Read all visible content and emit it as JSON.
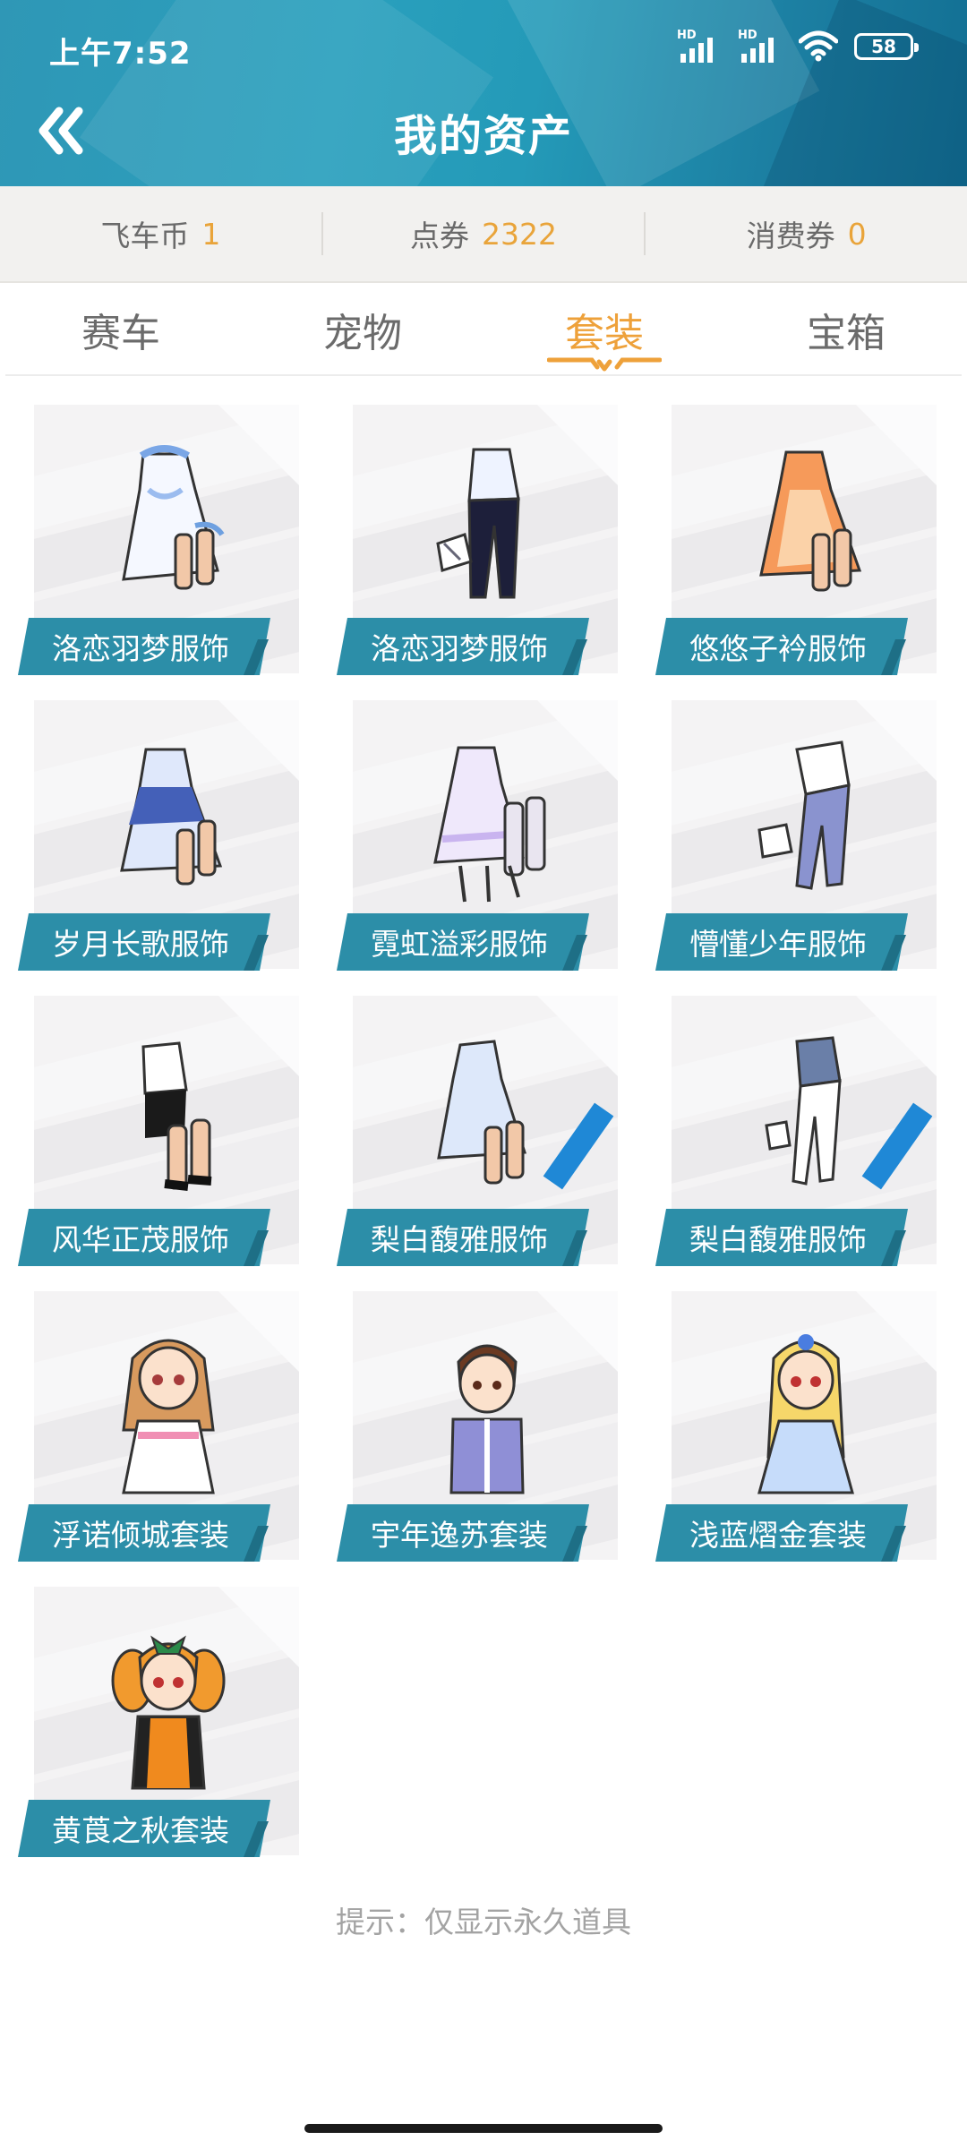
{
  "status_bar": {
    "time": "上午7:52",
    "signal_label_1": "HD",
    "signal_label_2": "HD",
    "battery": "58"
  },
  "header": {
    "title": "我的资产",
    "back_icon": "double-chevron-left-icon"
  },
  "currency": [
    {
      "label": "飞车币",
      "value": "1"
    },
    {
      "label": "点券",
      "value": "2322"
    },
    {
      "label": "消费券",
      "value": "0"
    }
  ],
  "tabs": [
    {
      "label": "赛车"
    },
    {
      "label": "宠物"
    },
    {
      "label": "套装"
    },
    {
      "label": "宝箱"
    }
  ],
  "active_tab": "套装",
  "items": [
    {
      "name": "洛恋羽梦服饰",
      "icon": "outfit-white-dress-icon"
    },
    {
      "name": "洛恋羽梦服饰",
      "icon": "outfit-suit-icon"
    },
    {
      "name": "悠悠子衿服饰",
      "icon": "outfit-orange-dress-icon"
    },
    {
      "name": "岁月长歌服饰",
      "icon": "outfit-blue-dress-icon"
    },
    {
      "name": "霓虹溢彩服饰",
      "icon": "outfit-lace-dress-icon"
    },
    {
      "name": "懵懂少年服饰",
      "icon": "outfit-boy-icon"
    },
    {
      "name": "风华正茂服饰",
      "icon": "outfit-black-white-icon"
    },
    {
      "name": "梨白馥雅服饰",
      "icon": "outfit-light-dress-icon"
    },
    {
      "name": "梨白馥雅服饰",
      "icon": "outfit-white-suit-icon"
    },
    {
      "name": "浮诺倾城套装",
      "icon": "girl-avatar-icon"
    },
    {
      "name": "宇年逸苏套装",
      "icon": "boy-avatar-icon"
    },
    {
      "name": "浅蓝熠金套装",
      "icon": "blonde-girl-avatar-icon"
    },
    {
      "name": "黄莨之秋套装",
      "icon": "orange-girl-avatar-icon"
    }
  ],
  "hint": "提示：仅显示永久道具",
  "colors": {
    "header": "#2aa0bd",
    "accent": "#eea13a",
    "label": "#2c8ea8"
  }
}
